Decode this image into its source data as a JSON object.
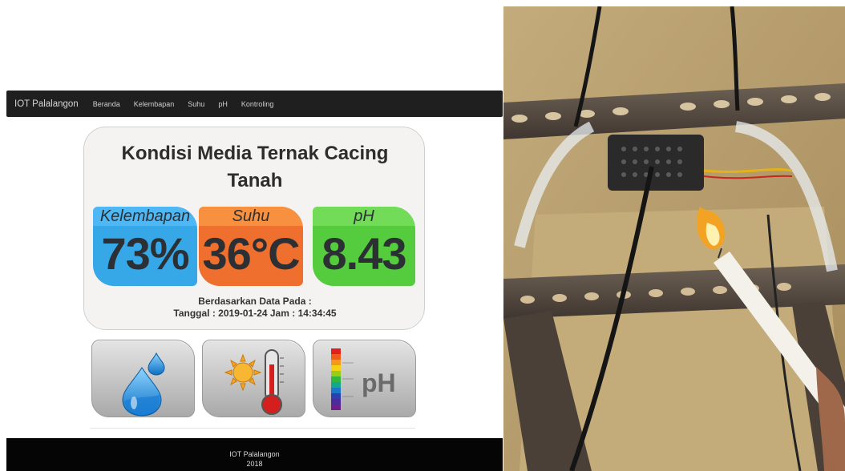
{
  "navbar": {
    "brand": "IOT Palalangon",
    "items": [
      "Beranda",
      "Kelembapan",
      "Suhu",
      "pH",
      "Kontroling"
    ]
  },
  "card": {
    "title_line1": "Kondisi Media Ternak Cacing",
    "title_line2": "Tanah",
    "tiles": [
      {
        "label": "Kelembapan",
        "value": "73%"
      },
      {
        "label": "Suhu",
        "value": "36°C"
      },
      {
        "label": "pH",
        "value": "8.43"
      }
    ],
    "based_label": "Berdasarkan Data Pada :",
    "datetime": "Tanggal : 2019-01-24 Jam : 14:34:45"
  },
  "buttons": {
    "water_icon": "water-drop-icon",
    "temp_icon": "sun-thermometer-icon",
    "ph_icon": "ph-scale-icon",
    "ph_text": "pH"
  },
  "footer": {
    "brand": "IOT Palalangon",
    "year": "2018"
  },
  "colors": {
    "navbar": "#1f1f1f",
    "humidity": "#36a8e8",
    "temperature": "#ee6f2e",
    "ph": "#55cc3d",
    "footer": "#050505"
  }
}
